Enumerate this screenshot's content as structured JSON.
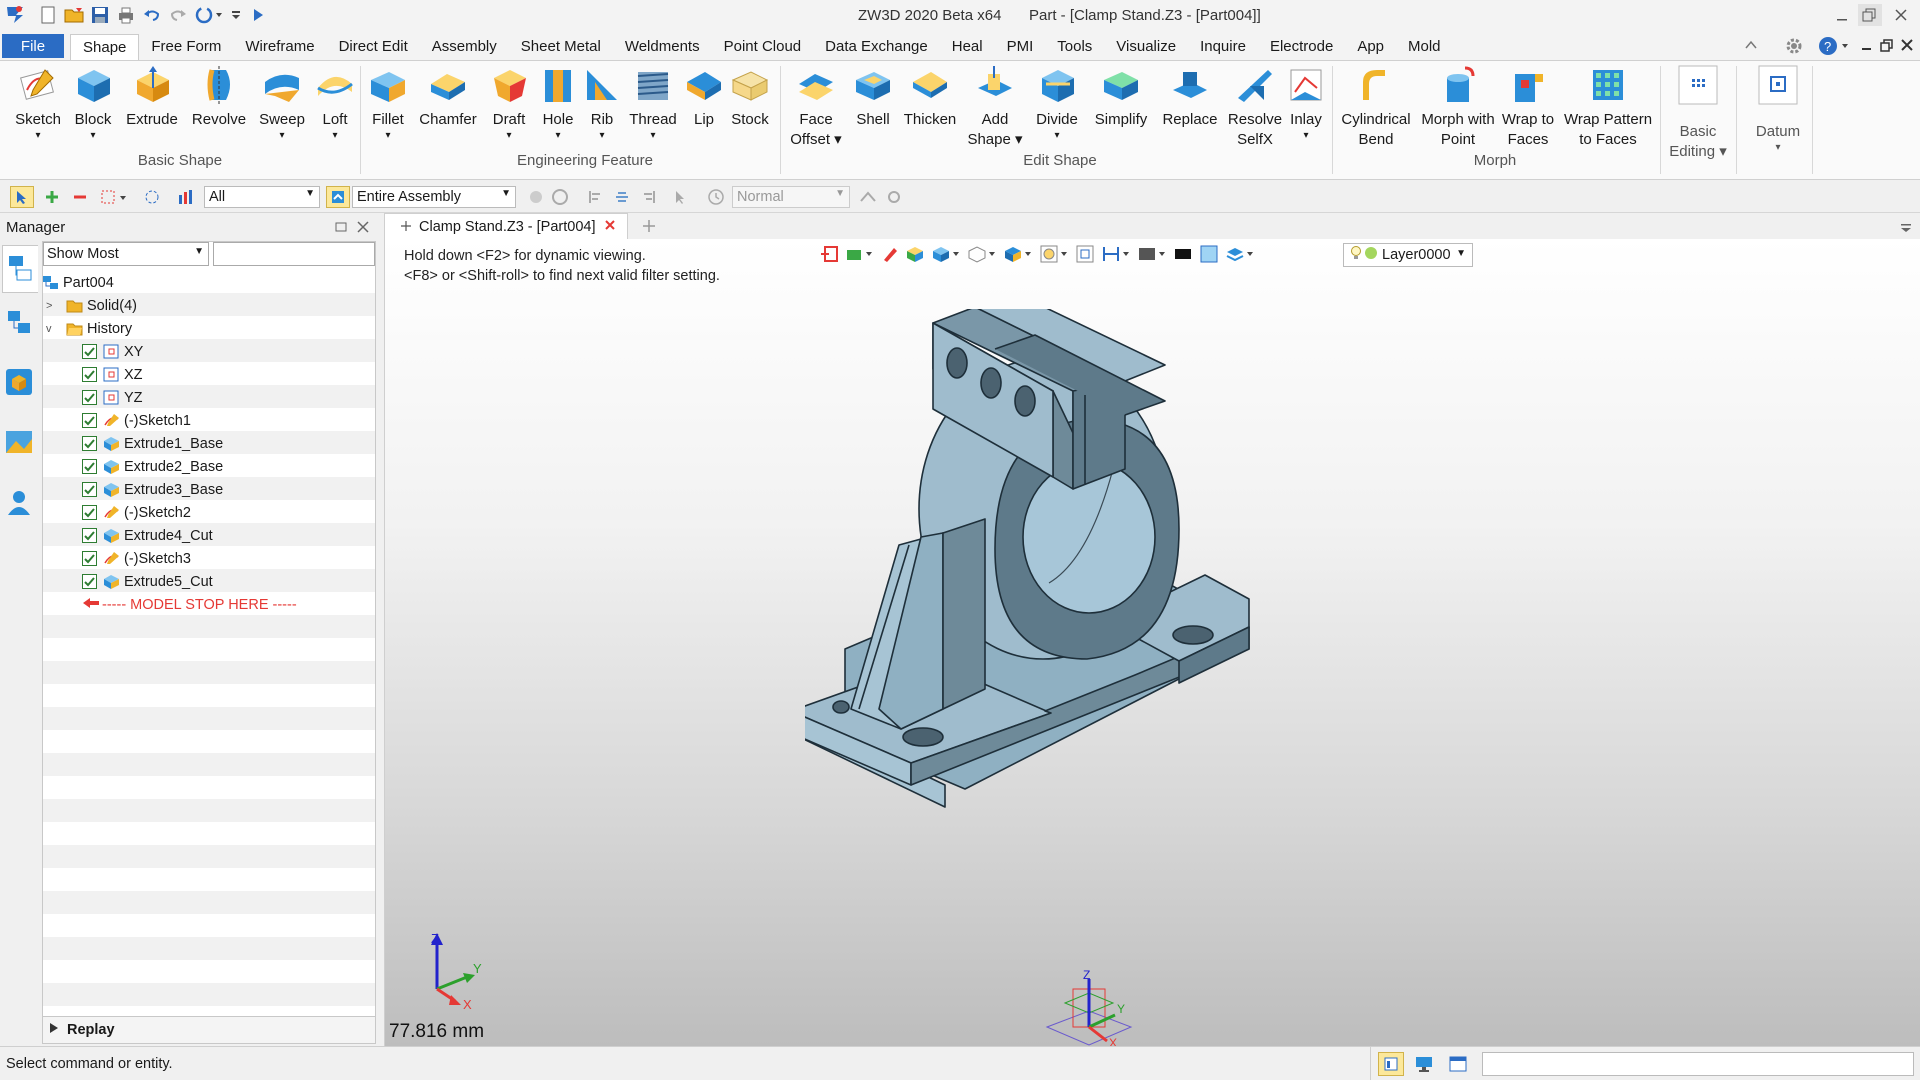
{
  "window": {
    "title": "ZW3D 2020 Beta x64",
    "doc_title": "Part - [Clamp Stand.Z3 - [Part004]]"
  },
  "menu": {
    "file": "File",
    "tabs": [
      "Shape",
      "Free Form",
      "Wireframe",
      "Direct Edit",
      "Assembly",
      "Sheet Metal",
      "Weldments",
      "Point Cloud",
      "Data Exchange",
      "Heal",
      "PMI",
      "Tools",
      "Visualize",
      "Inquire",
      "Electrode",
      "App",
      "Mold"
    ]
  },
  "ribbon": {
    "basic_shape": {
      "label": "Basic Shape",
      "items": [
        "Sketch",
        "Block",
        "Extrude",
        "Revolve",
        "Sweep",
        "Loft"
      ]
    },
    "engineering_feature": {
      "label": "Engineering Feature",
      "items": [
        "Fillet",
        "Chamfer",
        "Draft",
        "Hole",
        "Rib",
        "Thread",
        "Lip",
        "Stock"
      ]
    },
    "edit_shape": {
      "label": "Edit Shape",
      "items": [
        "Face\nOffset ▾",
        "Shell",
        "Thicken",
        "Add\nShape ▾",
        "Divide",
        "Simplify",
        "Replace",
        "Resolve\nSelfX",
        "Inlay"
      ]
    },
    "morph": {
      "label": "Morph",
      "items": [
        "Cylindrical\nBend",
        "Morph with\nPoint",
        "Wrap to\nFaces",
        "Wrap Pattern\nto Faces"
      ]
    },
    "basic_editing": {
      "label": "Basic\nEditing ▾"
    },
    "datum": {
      "label": "Datum"
    }
  },
  "filter_bar": {
    "filter_value": "All",
    "scope_value": "Entire Assembly",
    "mode_value": "Normal"
  },
  "manager": {
    "title": "Manager",
    "show_filter": "Show Most",
    "root": "Part004",
    "solid": "Solid(4)",
    "history": "History",
    "items": [
      "XY",
      "XZ",
      "YZ",
      "(-)Sketch1",
      "Extrude1_Base",
      "Extrude2_Base",
      "Extrude3_Base",
      "(-)Sketch2",
      "Extrude4_Cut",
      "(-)Sketch3",
      "Extrude5_Cut"
    ],
    "stop_marker": "----- MODEL STOP HERE -----",
    "replay": "Replay"
  },
  "document": {
    "tab_label": "Clamp Stand.Z3 - [Part004]",
    "hint_line1": "Hold down <F2> for dynamic viewing.",
    "hint_line2": "<F8> or <Shift-roll> to find next valid filter setting.",
    "layer": "Layer0000",
    "scale": "77.816 mm"
  },
  "status": {
    "message": "Select command or entity."
  },
  "colors": {
    "accent": "#2b6cc4",
    "model_light": "#9fbccd",
    "model_dark": "#5e7a8a",
    "viewport_top": "#ffffff",
    "viewport_bottom": "#bdbdbd"
  }
}
